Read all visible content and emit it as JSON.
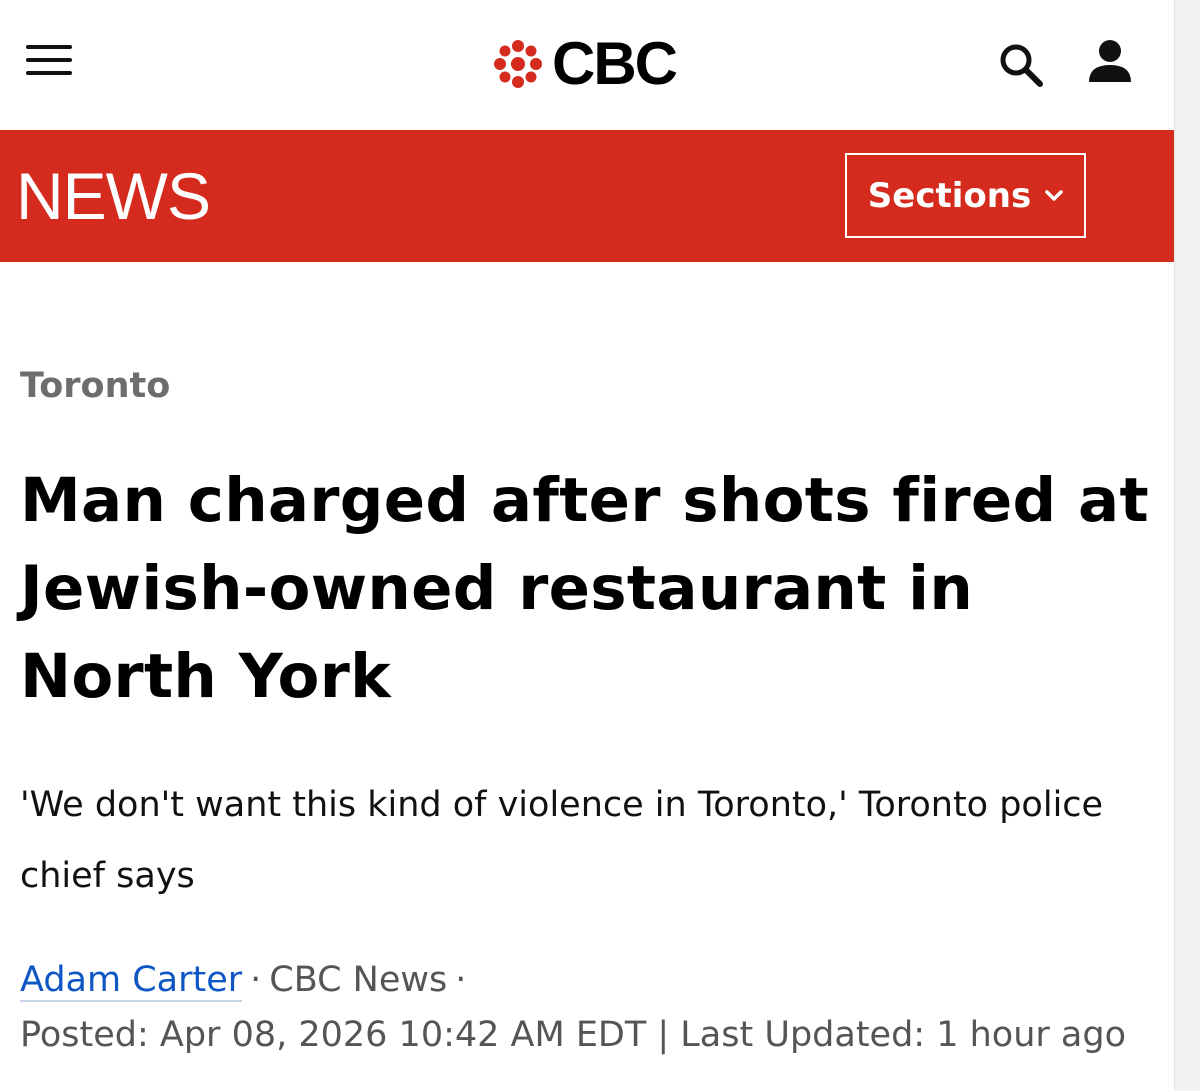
{
  "header": {
    "brand": "CBC",
    "menu_icon": "hamburger-menu-icon",
    "search_icon": "search-icon",
    "account_icon": "user-icon"
  },
  "section_bar": {
    "title": "NEWS",
    "sections_label": "Sections",
    "background_color": "#d52b1e"
  },
  "article": {
    "category": "Toronto",
    "headline": "Man charged after shots fired at Jewish-owned restaurant in North York",
    "deck": "'We don't want this kind of violence in Toronto,' Toronto police chief says",
    "author": "Adam Carter",
    "outlet": "CBC News",
    "separator": "·",
    "posted": "Posted: Apr 08, 2026 10:42 AM EDT | Last Updated: 1 hour ago"
  },
  "colors": {
    "accent_red": "#d52b1e",
    "author_link": "#0e56c4"
  }
}
